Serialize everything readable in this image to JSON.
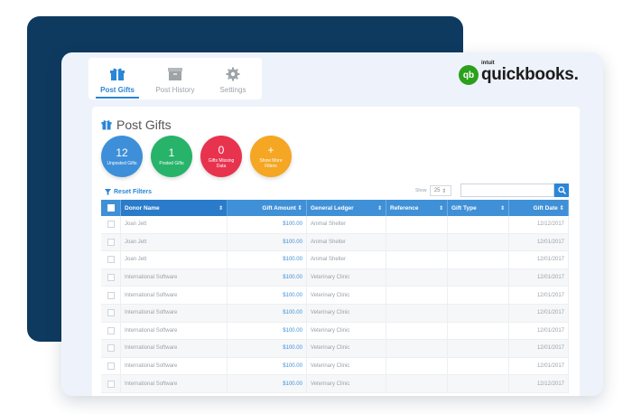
{
  "tabs": [
    {
      "label": "Post Gifts",
      "icon": "gift-icon",
      "active": true
    },
    {
      "label": "Post History",
      "icon": "archive-box-icon",
      "active": false
    },
    {
      "label": "Settings",
      "icon": "gear-icon",
      "active": false
    }
  ],
  "logo": {
    "badge": "qb",
    "intuit": "intuit",
    "name": "quickbooks."
  },
  "page": {
    "title": "Post Gifts"
  },
  "stats": [
    {
      "num": "12",
      "label": "Unposted Gifts",
      "color": "#3d8fd9"
    },
    {
      "num": "1",
      "label": "Posted Gifts",
      "color": "#27b36a"
    },
    {
      "num": "0",
      "label": "Gifts Missing Data",
      "color": "#e8334f"
    },
    {
      "num": "+",
      "label": "Show More Filters",
      "color": "#f5a623"
    }
  ],
  "filters": {
    "reset_label": "Reset Filters",
    "show_label": "Show",
    "show_value": "25"
  },
  "table": {
    "headers": [
      "Donor Name",
      "Gift Amount",
      "General Ledger",
      "Reference",
      "Gift Type",
      "Gift Date"
    ],
    "rows": [
      [
        "Joan Jett",
        "$100.00",
        "Animal Shelter",
        "",
        "",
        "12/12/2017"
      ],
      [
        "Joan Jett",
        "$100.00",
        "Animal Shelter",
        "",
        "",
        "12/01/2017"
      ],
      [
        "Joan Jett",
        "$100.00",
        "Animal Shelter",
        "",
        "",
        "12/01/2017"
      ],
      [
        "International Software",
        "$100.00",
        "Veterinary Clinic",
        "",
        "",
        "12/01/2017"
      ],
      [
        "International Software",
        "$100.00",
        "Veterinary Clinic",
        "",
        "",
        "12/01/2017"
      ],
      [
        "International Software",
        "$100.00",
        "Veterinary Clinic",
        "",
        "",
        "12/01/2017"
      ],
      [
        "International Software",
        "$100.00",
        "Veterinary Clinic",
        "",
        "",
        "12/01/2017"
      ],
      [
        "International Software",
        "$100.00",
        "Veterinary Clinic",
        "",
        "",
        "12/01/2017"
      ],
      [
        "International Software",
        "$100.00",
        "Veterinary Clinic",
        "",
        "",
        "12/01/2017"
      ],
      [
        "International Software",
        "$100.00",
        "Veterinary Clinic",
        "",
        "",
        "12/12/2017"
      ]
    ]
  }
}
